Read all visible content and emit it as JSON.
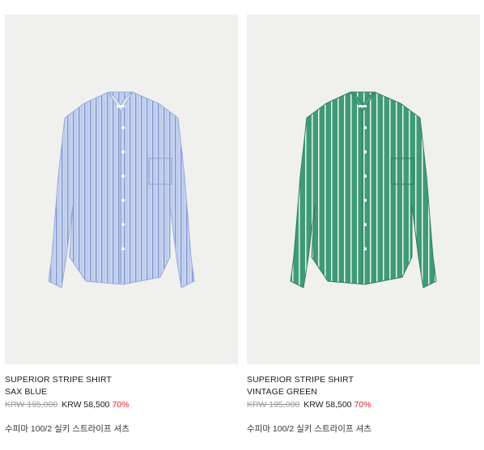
{
  "products": [
    {
      "name": "SUPERIOR STRIPE SHIRT",
      "color": "SAX BLUE",
      "original_price": "KRW 195,000",
      "sale_price": "KRW 58,500",
      "discount": "70%",
      "description": "수피마 100/2 실키 스트라이프 셔츠",
      "image_icon": "shirt-photo",
      "shirt_base": "#c9d5ef",
      "stripe_color": "#7f97d2"
    },
    {
      "name": "SUPERIOR STRIPE SHIRT",
      "color": "VINTAGE GREEN",
      "original_price": "KRW 195,000",
      "sale_price": "KRW 58,500",
      "discount": "70%",
      "description": "수피마 100/2 실키 스트라이프 셔츠",
      "image_icon": "shirt-photo",
      "shirt_base": "#3f9a78",
      "stripe_color": "#e8f3ee"
    }
  ],
  "colors": {
    "discount": "#e0202a",
    "muted": "#9a9a9a",
    "photo_bg": "#f0f0ee"
  }
}
